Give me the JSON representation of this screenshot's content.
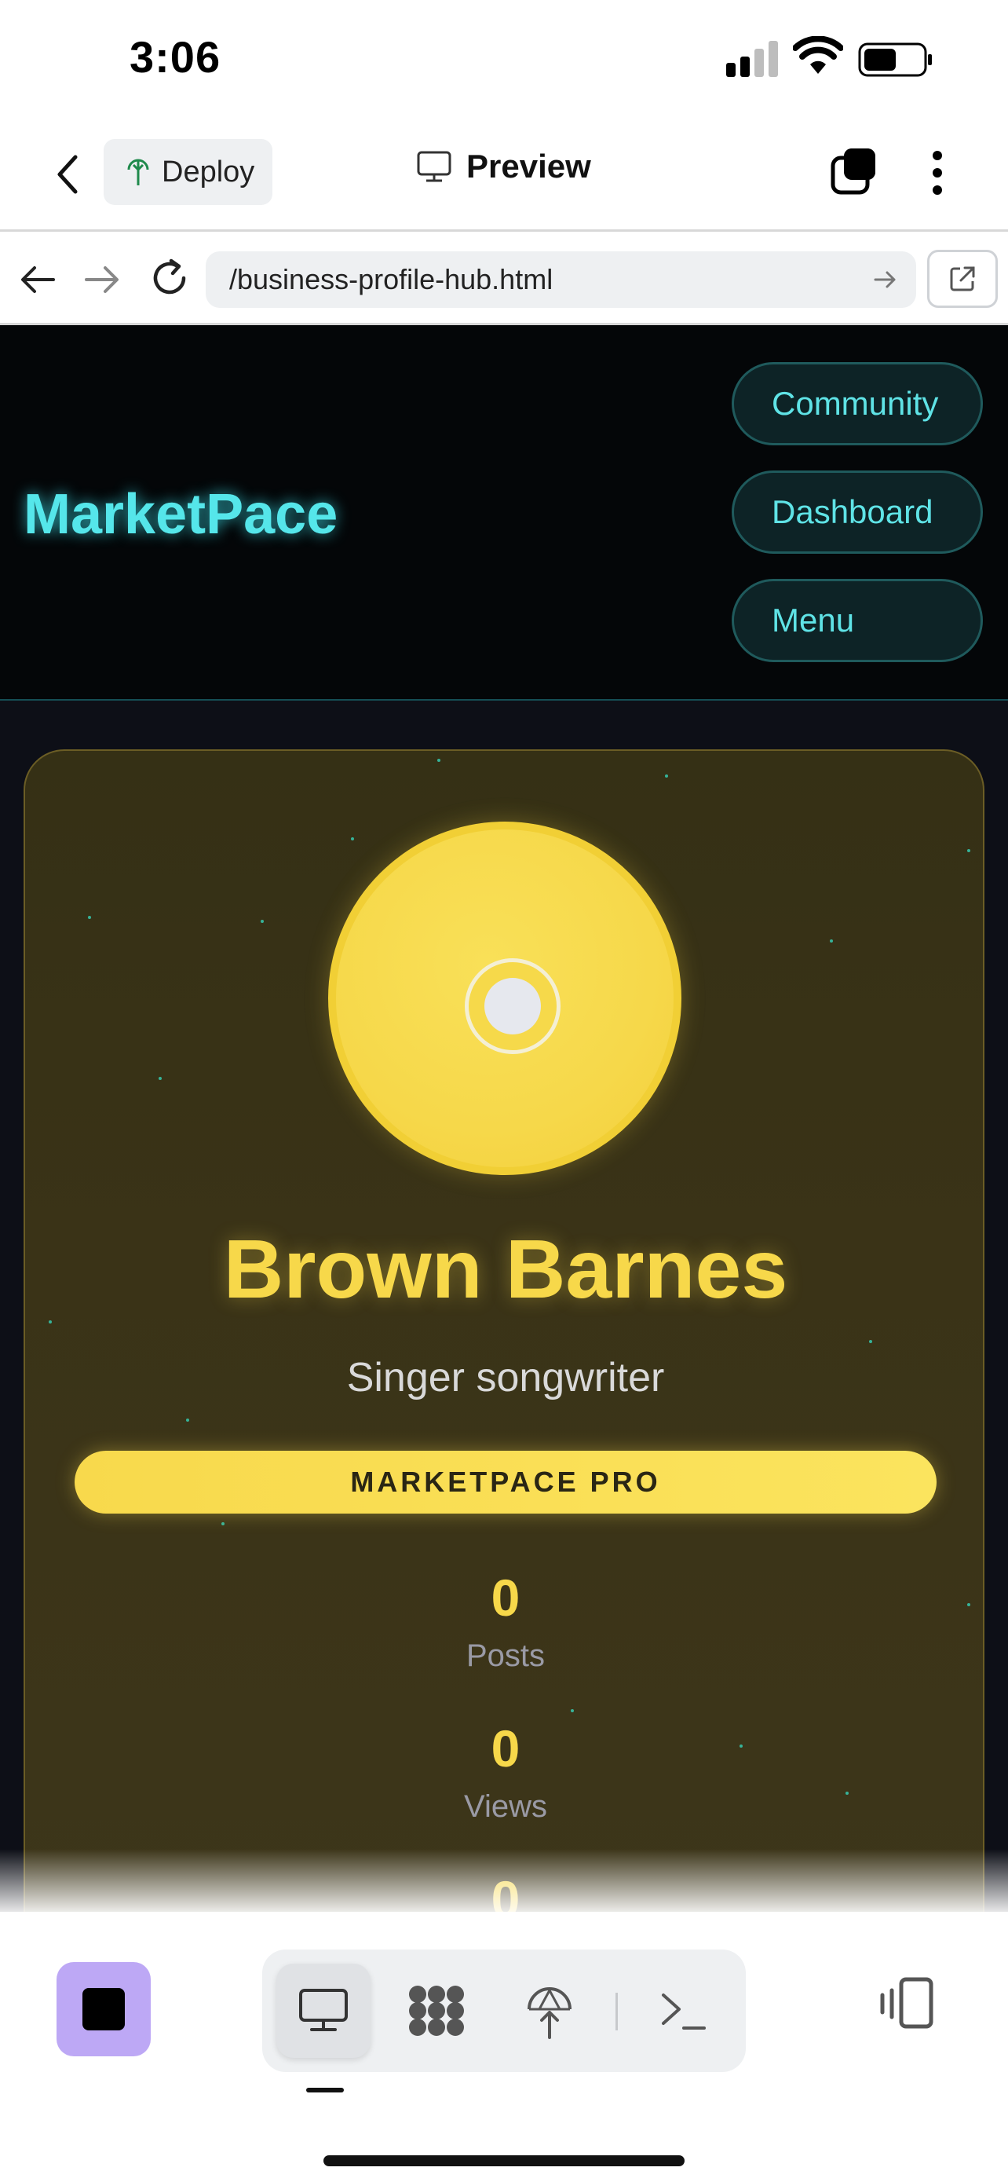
{
  "status_bar": {
    "time": "3:06"
  },
  "app_header": {
    "deploy_label": "Deploy",
    "preview_label": "Preview"
  },
  "url_bar": {
    "url": "/business-profile-hub.html"
  },
  "site": {
    "logo": "MarketPace",
    "nav": [
      "Community",
      "Dashboard",
      "Menu"
    ]
  },
  "profile": {
    "name": "Brown Barnes",
    "subtitle": "Singer songwriter",
    "badge": "MARKETPACE PRO",
    "stats": [
      {
        "value": "0",
        "label": "Posts"
      },
      {
        "value": "0",
        "label": "Views"
      },
      {
        "value": "0",
        "label": ""
      }
    ]
  },
  "colors": {
    "accent_cyan": "#55e6ea",
    "accent_gold": "#f7d84a",
    "stop_button": "#bda8f5"
  },
  "icons": {
    "back": "chevron-left-icon",
    "deploy": "deploy-tree-icon",
    "preview": "monitor-icon",
    "tabs": "tabs-icon",
    "more": "kebab-icon",
    "toolbar": [
      "monitor-icon",
      "grid-icon",
      "deploy-icon",
      "terminal-icon"
    ]
  }
}
